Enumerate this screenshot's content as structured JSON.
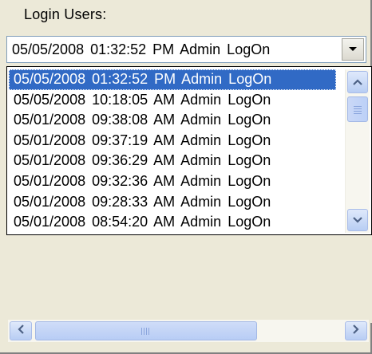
{
  "panel": {
    "title": "Login Users:"
  },
  "combo": {
    "value": "05/05/2008 01:32:52 PM  Admin  LogOn"
  },
  "list": {
    "items": [
      "05/05/2008 01:32:52 PM  Admin  LogOn",
      "05/05/2008 10:18:05 AM  Admin  LogOn",
      "05/01/2008 09:38:08 AM  Admin  LogOn",
      "05/01/2008 09:37:19 AM  Admin  LogOn",
      "05/01/2008 09:36:29 AM  Admin  LogOn",
      "05/01/2008 09:32:36 AM  Admin  LogOn",
      "05/01/2008 09:28:33 AM  Admin  LogOn",
      "05/01/2008 08:54:20 AM  Admin  LogOn"
    ],
    "selected_index": 0
  },
  "icons": {
    "dropdown": "chevron-down-icon",
    "scroll_up": "chevron-up-icon",
    "scroll_down": "chevron-down-icon",
    "scroll_left": "chevron-left-icon",
    "scroll_right": "chevron-right-icon"
  },
  "colors": {
    "selection": "#316ac5",
    "window_bg": "#ece9d8",
    "scrollbar_accent": "#b8cdf3"
  }
}
